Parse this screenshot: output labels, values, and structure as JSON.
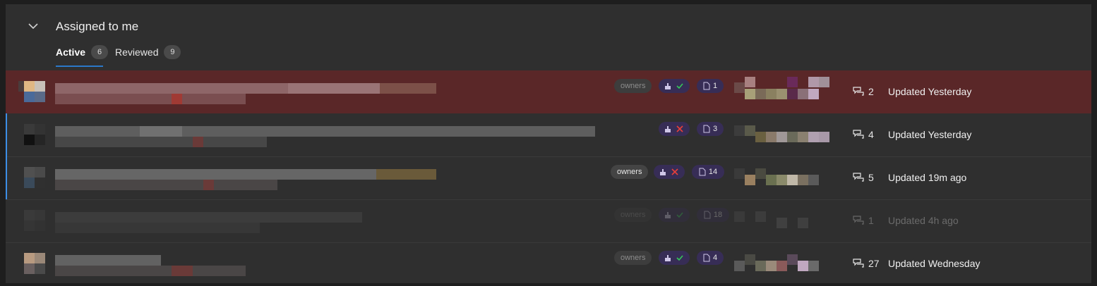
{
  "section": {
    "title": "Assigned to me",
    "collapse_icon": "chevron-down-icon"
  },
  "tabs": [
    {
      "label": "Active",
      "count": "6"
    },
    {
      "label": "Reviewed",
      "count": "9"
    }
  ],
  "colors": {
    "accent": "#2b78c8",
    "selected_row": "#5a2728",
    "pill_bg": "#372d56",
    "approved": "#35c759",
    "rejected": "#e8403a"
  },
  "rows": [
    {
      "owners": "owners",
      "policy_status": "approved",
      "files": "1",
      "comments": "2",
      "updated": "Updated Yesterday"
    },
    {
      "policy_status": "rejected",
      "files": "3",
      "comments": "4",
      "updated": "Updated Yesterday"
    },
    {
      "owners": "owners",
      "policy_status": "rejected",
      "files": "14",
      "comments": "5",
      "updated": "Updated 19m ago"
    },
    {
      "owners": "owners",
      "policy_status": "approved",
      "files": "18",
      "comments": "1",
      "updated": "Updated 4h ago"
    },
    {
      "owners": "owners",
      "policy_status": "approved",
      "files": "4",
      "comments": "27",
      "updated": "Updated Wednesday"
    }
  ]
}
